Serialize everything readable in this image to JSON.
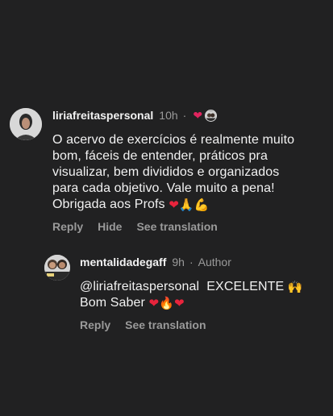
{
  "comments": [
    {
      "username": "liriafreitaspersonal",
      "time": "10h",
      "separator": "·",
      "text_lines": [
        "O acervo de exercícios é realmente muito",
        "bom, fáceis de entender, práticos pra",
        "visualizar, bem divididos e organizados",
        "para cada objetivo. Vale muito a pena!",
        "Obrigada aos Profs"
      ],
      "emojis": [
        "❤",
        "🙏",
        "💪"
      ],
      "actions": {
        "reply": "Reply",
        "hide": "Hide",
        "translate": "See translation"
      },
      "icons": {
        "liked": "heart-icon",
        "liker": "author-avatar-icon"
      }
    },
    {
      "username": "mentalidadegaff",
      "time": "9h",
      "separator": "·",
      "author": "Author",
      "mention": "@liriafreitaspersonal",
      "text_after_mention": "EXCELENTE",
      "line2": "Bom Saber",
      "emojis_line1": [
        "🙌"
      ],
      "emojis_line2": [
        "❤",
        "🔥",
        "❤"
      ],
      "actions": {
        "reply": "Reply",
        "translate": "See translation"
      }
    }
  ],
  "colors": {
    "background": "#212122",
    "text": "#f2f2f2",
    "muted": "#9a9a9a",
    "like": "#e0245e"
  }
}
